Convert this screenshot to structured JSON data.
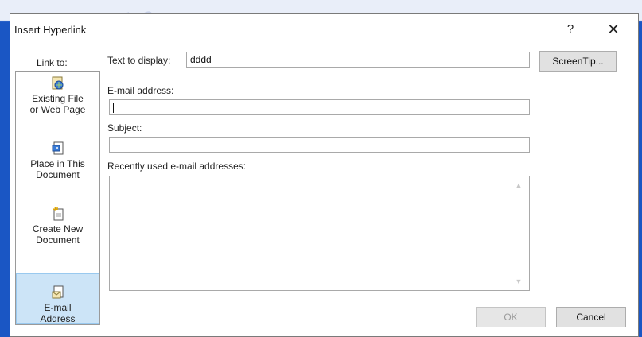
{
  "window": {
    "title": "Insert Hyperlink",
    "help_label": "?",
    "close_label": "✕"
  },
  "sidebar": {
    "heading": "Link to:",
    "items": [
      {
        "line1": "Existing File",
        "line2": "or Web Page",
        "icon": "existing-file-icon",
        "selected": false
      },
      {
        "line1": "Place in This",
        "line2": "Document",
        "icon": "place-in-document-icon",
        "selected": false
      },
      {
        "line1": "Create New",
        "line2": "Document",
        "icon": "create-new-document-icon",
        "selected": false
      },
      {
        "line1": "E-mail",
        "line2": "Address",
        "icon": "email-address-icon",
        "selected": true
      }
    ]
  },
  "text_to_display": {
    "label": "Text to display:",
    "value": "dddd"
  },
  "screentip": {
    "label": "ScreenTip..."
  },
  "email": {
    "label": "E-mail address:",
    "value": ""
  },
  "subject": {
    "label": "Subject:",
    "value": ""
  },
  "recent": {
    "label": "Recently used e-mail addresses:",
    "items": []
  },
  "buttons": {
    "ok": "OK",
    "cancel": "Cancel"
  },
  "colors": {
    "accent": "#1a56c4",
    "selected_bg": "#cce4f7",
    "selected_border": "#99c9ef"
  }
}
